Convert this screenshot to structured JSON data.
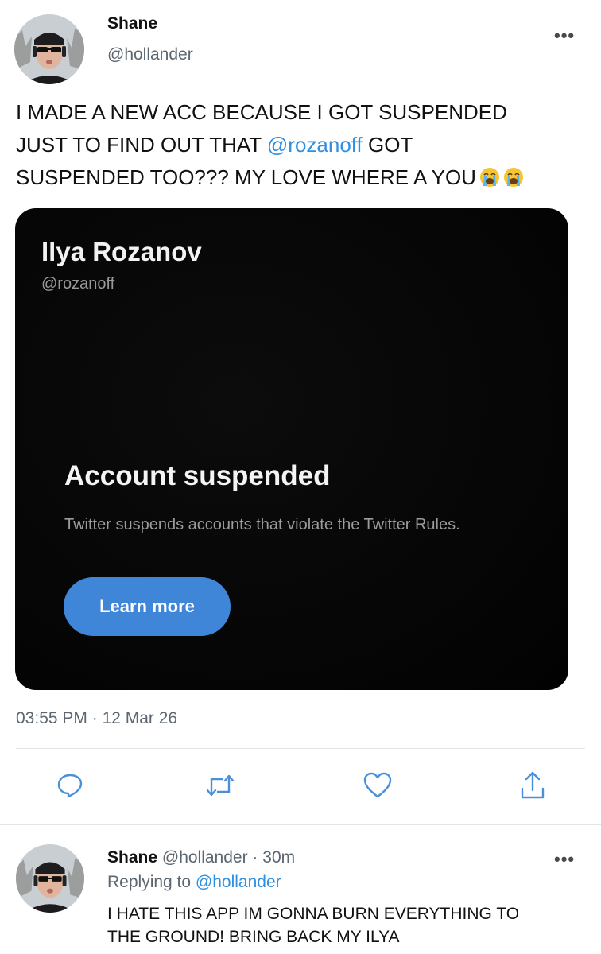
{
  "tweet": {
    "author_name": "Shane",
    "author_handle": "@hollander",
    "text_line1": "I MADE A NEW ACC BECAUSE I GOT SUSPENDED",
    "text_line2_pre": "JUST TO FIND OUT THAT ",
    "text_line2_mention": "@rozanoff",
    "text_line2_post": " GOT",
    "text_line3": "SUSPENDED TOO??? MY LOVE WHERE A YOU",
    "emoji": [
      "loudly-crying-face",
      "loudly-crying-face"
    ],
    "timestamp": "03:55 PM",
    "date_sep": " · ",
    "date": "12 Mar 26",
    "more_icon": "•••"
  },
  "embedded_card": {
    "name": "Ilya Rozanov",
    "handle": "@rozanoff",
    "title": "Account suspended",
    "description": "Twitter suspends accounts that violate the Twitter Rules.",
    "button_label": "Learn more"
  },
  "actions": [
    {
      "icon": "reply-icon"
    },
    {
      "icon": "retweet-icon"
    },
    {
      "icon": "heart-icon"
    },
    {
      "icon": "share-icon"
    }
  ],
  "reply": {
    "author_name": "Shane",
    "author_handle": "@hollander",
    "time_sep": " · ",
    "time": "30m",
    "replying_to_label": "Replying to",
    "replying_to_handle": "@hollander",
    "text_line1": "I HATE THIS APP IM GONNA BURN EVERYTHING TO",
    "text_line2": "THE GROUND! BRING BACK MY ILYA",
    "more_icon": "•••"
  },
  "colors": {
    "link": "#2f8fe0",
    "button": "#3f86d8",
    "card_bg": "#050505"
  }
}
